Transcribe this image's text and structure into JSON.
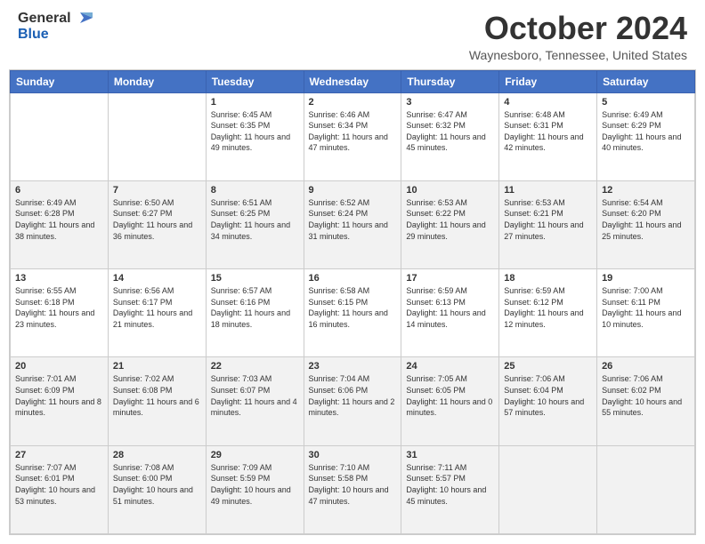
{
  "header": {
    "logo_general": "General",
    "logo_blue": "Blue",
    "month_title": "October 2024",
    "location": "Waynesboro, Tennessee, United States"
  },
  "days_of_week": [
    "Sunday",
    "Monday",
    "Tuesday",
    "Wednesday",
    "Thursday",
    "Friday",
    "Saturday"
  ],
  "weeks": [
    [
      {
        "day": "",
        "info": ""
      },
      {
        "day": "",
        "info": ""
      },
      {
        "day": "1",
        "info": "Sunrise: 6:45 AM\nSunset: 6:35 PM\nDaylight: 11 hours and 49 minutes."
      },
      {
        "day": "2",
        "info": "Sunrise: 6:46 AM\nSunset: 6:34 PM\nDaylight: 11 hours and 47 minutes."
      },
      {
        "day": "3",
        "info": "Sunrise: 6:47 AM\nSunset: 6:32 PM\nDaylight: 11 hours and 45 minutes."
      },
      {
        "day": "4",
        "info": "Sunrise: 6:48 AM\nSunset: 6:31 PM\nDaylight: 11 hours and 42 minutes."
      },
      {
        "day": "5",
        "info": "Sunrise: 6:49 AM\nSunset: 6:29 PM\nDaylight: 11 hours and 40 minutes."
      }
    ],
    [
      {
        "day": "6",
        "info": "Sunrise: 6:49 AM\nSunset: 6:28 PM\nDaylight: 11 hours and 38 minutes."
      },
      {
        "day": "7",
        "info": "Sunrise: 6:50 AM\nSunset: 6:27 PM\nDaylight: 11 hours and 36 minutes."
      },
      {
        "day": "8",
        "info": "Sunrise: 6:51 AM\nSunset: 6:25 PM\nDaylight: 11 hours and 34 minutes."
      },
      {
        "day": "9",
        "info": "Sunrise: 6:52 AM\nSunset: 6:24 PM\nDaylight: 11 hours and 31 minutes."
      },
      {
        "day": "10",
        "info": "Sunrise: 6:53 AM\nSunset: 6:22 PM\nDaylight: 11 hours and 29 minutes."
      },
      {
        "day": "11",
        "info": "Sunrise: 6:53 AM\nSunset: 6:21 PM\nDaylight: 11 hours and 27 minutes."
      },
      {
        "day": "12",
        "info": "Sunrise: 6:54 AM\nSunset: 6:20 PM\nDaylight: 11 hours and 25 minutes."
      }
    ],
    [
      {
        "day": "13",
        "info": "Sunrise: 6:55 AM\nSunset: 6:18 PM\nDaylight: 11 hours and 23 minutes."
      },
      {
        "day": "14",
        "info": "Sunrise: 6:56 AM\nSunset: 6:17 PM\nDaylight: 11 hours and 21 minutes."
      },
      {
        "day": "15",
        "info": "Sunrise: 6:57 AM\nSunset: 6:16 PM\nDaylight: 11 hours and 18 minutes."
      },
      {
        "day": "16",
        "info": "Sunrise: 6:58 AM\nSunset: 6:15 PM\nDaylight: 11 hours and 16 minutes."
      },
      {
        "day": "17",
        "info": "Sunrise: 6:59 AM\nSunset: 6:13 PM\nDaylight: 11 hours and 14 minutes."
      },
      {
        "day": "18",
        "info": "Sunrise: 6:59 AM\nSunset: 6:12 PM\nDaylight: 11 hours and 12 minutes."
      },
      {
        "day": "19",
        "info": "Sunrise: 7:00 AM\nSunset: 6:11 PM\nDaylight: 11 hours and 10 minutes."
      }
    ],
    [
      {
        "day": "20",
        "info": "Sunrise: 7:01 AM\nSunset: 6:09 PM\nDaylight: 11 hours and 8 minutes."
      },
      {
        "day": "21",
        "info": "Sunrise: 7:02 AM\nSunset: 6:08 PM\nDaylight: 11 hours and 6 minutes."
      },
      {
        "day": "22",
        "info": "Sunrise: 7:03 AM\nSunset: 6:07 PM\nDaylight: 11 hours and 4 minutes."
      },
      {
        "day": "23",
        "info": "Sunrise: 7:04 AM\nSunset: 6:06 PM\nDaylight: 11 hours and 2 minutes."
      },
      {
        "day": "24",
        "info": "Sunrise: 7:05 AM\nSunset: 6:05 PM\nDaylight: 11 hours and 0 minutes."
      },
      {
        "day": "25",
        "info": "Sunrise: 7:06 AM\nSunset: 6:04 PM\nDaylight: 10 hours and 57 minutes."
      },
      {
        "day": "26",
        "info": "Sunrise: 7:06 AM\nSunset: 6:02 PM\nDaylight: 10 hours and 55 minutes."
      }
    ],
    [
      {
        "day": "27",
        "info": "Sunrise: 7:07 AM\nSunset: 6:01 PM\nDaylight: 10 hours and 53 minutes."
      },
      {
        "day": "28",
        "info": "Sunrise: 7:08 AM\nSunset: 6:00 PM\nDaylight: 10 hours and 51 minutes."
      },
      {
        "day": "29",
        "info": "Sunrise: 7:09 AM\nSunset: 5:59 PM\nDaylight: 10 hours and 49 minutes."
      },
      {
        "day": "30",
        "info": "Sunrise: 7:10 AM\nSunset: 5:58 PM\nDaylight: 10 hours and 47 minutes."
      },
      {
        "day": "31",
        "info": "Sunrise: 7:11 AM\nSunset: 5:57 PM\nDaylight: 10 hours and 45 minutes."
      },
      {
        "day": "",
        "info": ""
      },
      {
        "day": "",
        "info": ""
      }
    ]
  ]
}
